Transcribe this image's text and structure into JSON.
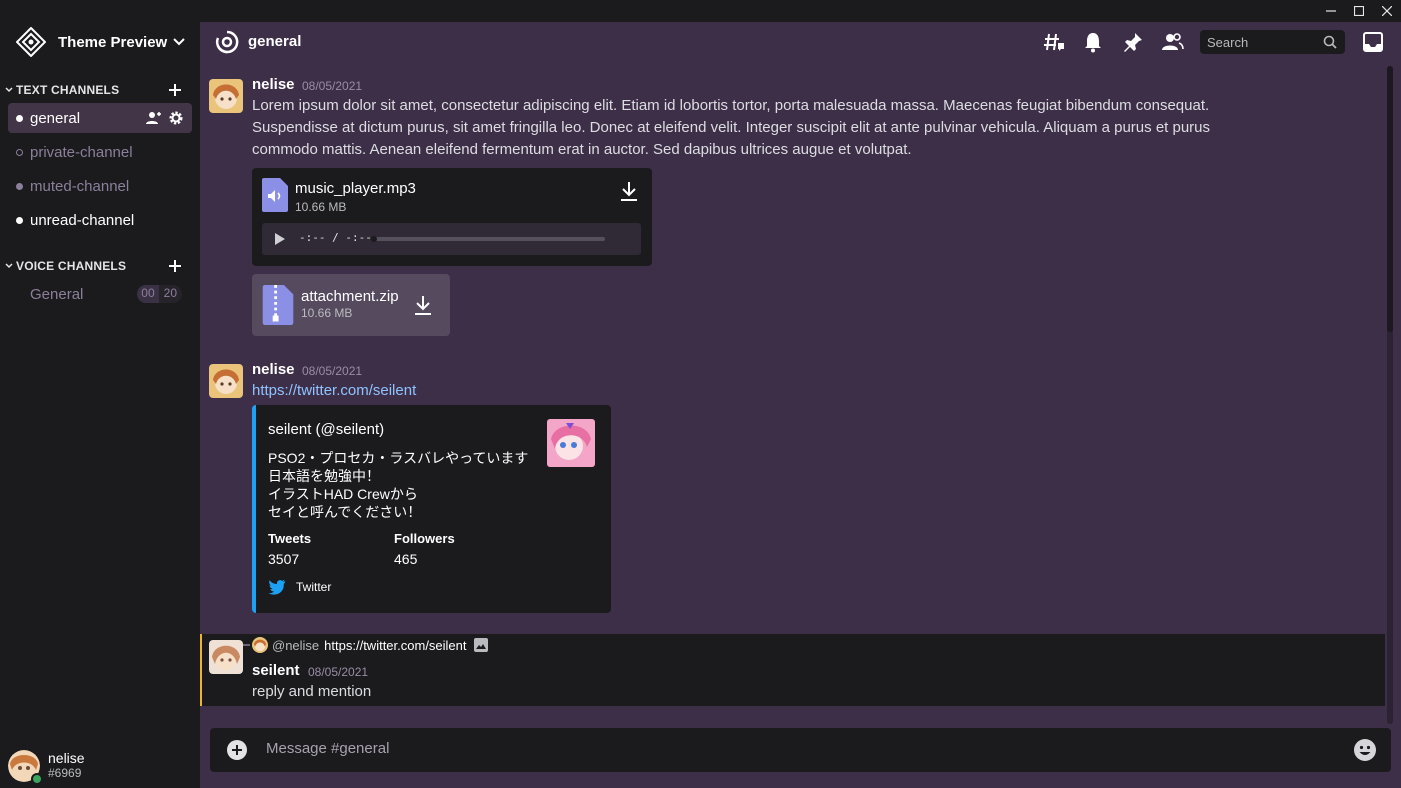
{
  "window": {
    "minimize": "—",
    "maximize": "☐",
    "close": "✕"
  },
  "guild": {
    "name": "Theme Preview",
    "logo_icon": "theme-logo-icon"
  },
  "categories": {
    "text": {
      "label": "TEXT CHANNELS"
    },
    "voice": {
      "label": "VOICE CHANNELS"
    }
  },
  "text_channels": [
    {
      "label": "general",
      "state": "active",
      "color": "#ffffff"
    },
    {
      "label": "private-channel",
      "state": "private",
      "color": "#8c7f9b"
    },
    {
      "label": "muted-channel",
      "state": "muted",
      "color": "#8c7f9b"
    },
    {
      "label": "unread-channel",
      "state": "unread",
      "color": "#ffffff"
    }
  ],
  "voice_channels": [
    {
      "label": "General",
      "user_count": "00",
      "user_limit": "20"
    }
  ],
  "user": {
    "name": "nelise",
    "tag": "#6969",
    "status_color": "#3ba55d"
  },
  "header": {
    "channel": "general",
    "search_placeholder": "Search"
  },
  "messages": [
    {
      "author": "nelise",
      "timestamp": "08/05/2021",
      "lines": [
        "Lorem ipsum dolor sit amet, consectetur adipiscing elit. Etiam id lobortis tortor, porta malesuada massa. Maecenas feugiat bibendum consequat.",
        "Suspendisse at dictum purus, sit amet fringilla leo. Donec at eleifend velit. Integer suscipit elit at ante pulvinar vehicula. Aliquam a purus et purus",
        "commodo mattis. Aenean eleifend fermentum erat in auctor. Sed dapibus ultrices augue et volutpat."
      ],
      "audio": {
        "filename": "music_player.mp3",
        "size": "10.66 MB",
        "time": "-:-- / -:--",
        "progress": 0
      },
      "attachment": {
        "filename": "attachment.zip",
        "size": "10.66 MB"
      }
    },
    {
      "author": "nelise",
      "timestamp": "08/05/2021",
      "link": "https://twitter.com/seilent",
      "embed": {
        "accent": "#1da1f2",
        "author": "seilent (@seilent)",
        "description": [
          "PSO2・プロセカ・ラスバレやっています",
          "日本語を勉強中！",
          "イラストHAD Crewから",
          "セイと呼んでください！"
        ],
        "fields": [
          {
            "name": "Tweets",
            "value": "3507"
          },
          {
            "name": "Followers",
            "value": "465"
          }
        ],
        "footer": "Twitter"
      }
    },
    {
      "author": "seilent",
      "timestamp": "08/05/2021",
      "text": "reply and mention",
      "reply_to": {
        "mention": "@nelise",
        "text": "https://twitter.com/seilent"
      }
    }
  ],
  "composer": {
    "placeholder": "Message #general"
  }
}
